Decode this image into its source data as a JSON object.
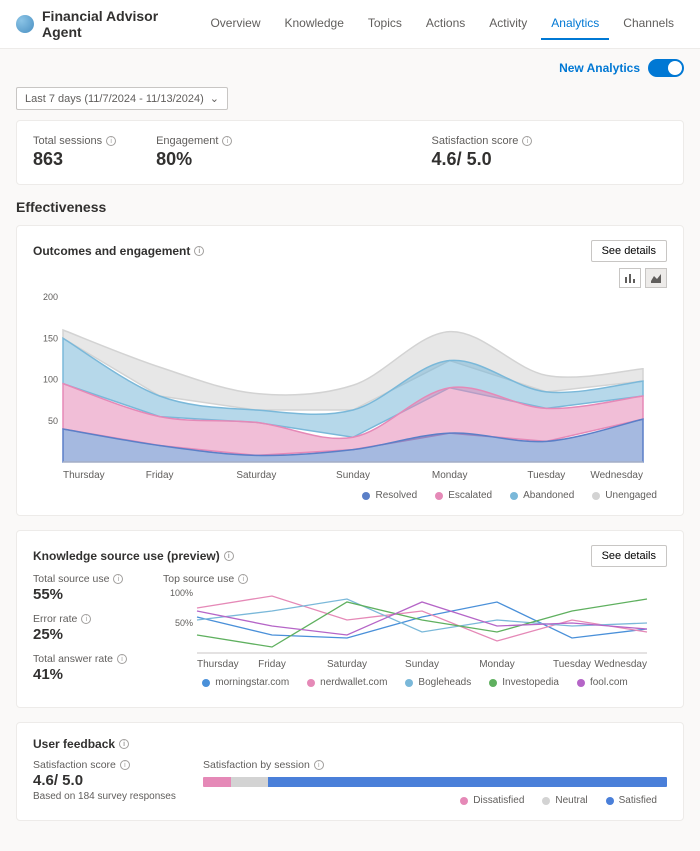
{
  "header": {
    "title": "Financial Advisor Agent",
    "tabs": [
      "Overview",
      "Knowledge",
      "Topics",
      "Actions",
      "Activity",
      "Analytics",
      "Channels"
    ],
    "active_tab": 5
  },
  "new_analytics_label": "New Analytics",
  "date_range": "Last 7 days (11/7/2024 - 11/13/2024)",
  "kpis": {
    "sessions_label": "Total sessions",
    "sessions_value": "863",
    "engagement_label": "Engagement",
    "engagement_value": "80%",
    "satisfaction_label": "Satisfaction score",
    "satisfaction_value": "4.6/ 5.0"
  },
  "effectiveness_title": "Effectiveness",
  "outcomes": {
    "title": "Outcomes and engagement",
    "see_details": "See details",
    "legend": {
      "resolved": "Resolved",
      "escalated": "Escalated",
      "abandoned": "Abandoned",
      "unengaged": "Unengaged"
    },
    "colors": {
      "resolved": "#5b7fc7",
      "escalated": "#e589b7",
      "abandoned": "#7ab8d9",
      "unengaged": "#d3d3d3"
    }
  },
  "knowledge": {
    "title": "Knowledge source use (preview)",
    "see_details": "See details",
    "total_source_label": "Total source use",
    "total_source_value": "55%",
    "error_label": "Error rate",
    "error_value": "25%",
    "answer_label": "Total answer rate",
    "answer_value": "41%",
    "top_source_label": "Top source use",
    "legend": [
      "morningstar.com",
      "nerdwallet.com",
      "Bogleheads",
      "Investopedia",
      "fool.com"
    ],
    "legend_colors": [
      "#4a90d9",
      "#e589b7",
      "#7ab8d9",
      "#5fb05f",
      "#b565c7"
    ]
  },
  "feedback": {
    "title": "User feedback",
    "score_label": "Satisfaction score",
    "score_value": "4.6/ 5.0",
    "based_on": "Based on 184 survey responses",
    "session_label": "Satisfaction by session",
    "dissatisfied": "Dissatisfied",
    "neutral": "Neutral",
    "satisfied": "Satisfied",
    "colors": {
      "dissatisfied": "#e589b7",
      "neutral": "#d3d3d3",
      "satisfied": "#4a7fd9"
    },
    "segments": {
      "dissatisfied": 6,
      "neutral": 8,
      "satisfied": 86
    }
  },
  "chart_data": [
    {
      "type": "area",
      "title": "Outcomes and engagement",
      "categories": [
        "Thursday",
        "Friday",
        "Saturday",
        "Sunday",
        "Monday",
        "Tuesday",
        "Wednesday"
      ],
      "ylim": [
        0,
        200
      ],
      "yticks": [
        50,
        100,
        150,
        200
      ],
      "series": [
        {
          "name": "Resolved",
          "color": "#5b7fc7",
          "values": [
            40,
            20,
            8,
            15,
            35,
            25,
            52
          ]
        },
        {
          "name": "Escalated",
          "color": "#e589b7",
          "values": [
            55,
            35,
            40,
            15,
            55,
            40,
            28
          ]
        },
        {
          "name": "Abandoned",
          "color": "#7ab8d9",
          "values": [
            55,
            25,
            15,
            33,
            33,
            20,
            18
          ]
        },
        {
          "name": "Unengaged",
          "color": "#d3d3d3",
          "values": [
            10,
            35,
            20,
            30,
            35,
            20,
            15
          ]
        }
      ]
    },
    {
      "type": "line",
      "title": "Top source use",
      "categories": [
        "Thursday",
        "Friday",
        "Saturday",
        "Sunday",
        "Monday",
        "Tuesday",
        "Wednesday"
      ],
      "ylim": [
        0,
        100
      ],
      "yticks": [
        50,
        100
      ],
      "ylabel_suffix": "%",
      "series": [
        {
          "name": "morningstar.com",
          "color": "#4a90d9",
          "values": [
            60,
            30,
            25,
            60,
            85,
            25,
            40
          ]
        },
        {
          "name": "nerdwallet.com",
          "color": "#e589b7",
          "values": [
            75,
            95,
            55,
            70,
            20,
            55,
            35
          ]
        },
        {
          "name": "Bogleheads",
          "color": "#7ab8d9",
          "values": [
            55,
            70,
            90,
            35,
            55,
            45,
            50
          ]
        },
        {
          "name": "Investopedia",
          "color": "#5fb05f",
          "values": [
            30,
            10,
            85,
            55,
            35,
            70,
            90
          ]
        },
        {
          "name": "fool.com",
          "color": "#b565c7",
          "values": [
            70,
            45,
            30,
            85,
            45,
            50,
            40
          ]
        }
      ]
    }
  ]
}
